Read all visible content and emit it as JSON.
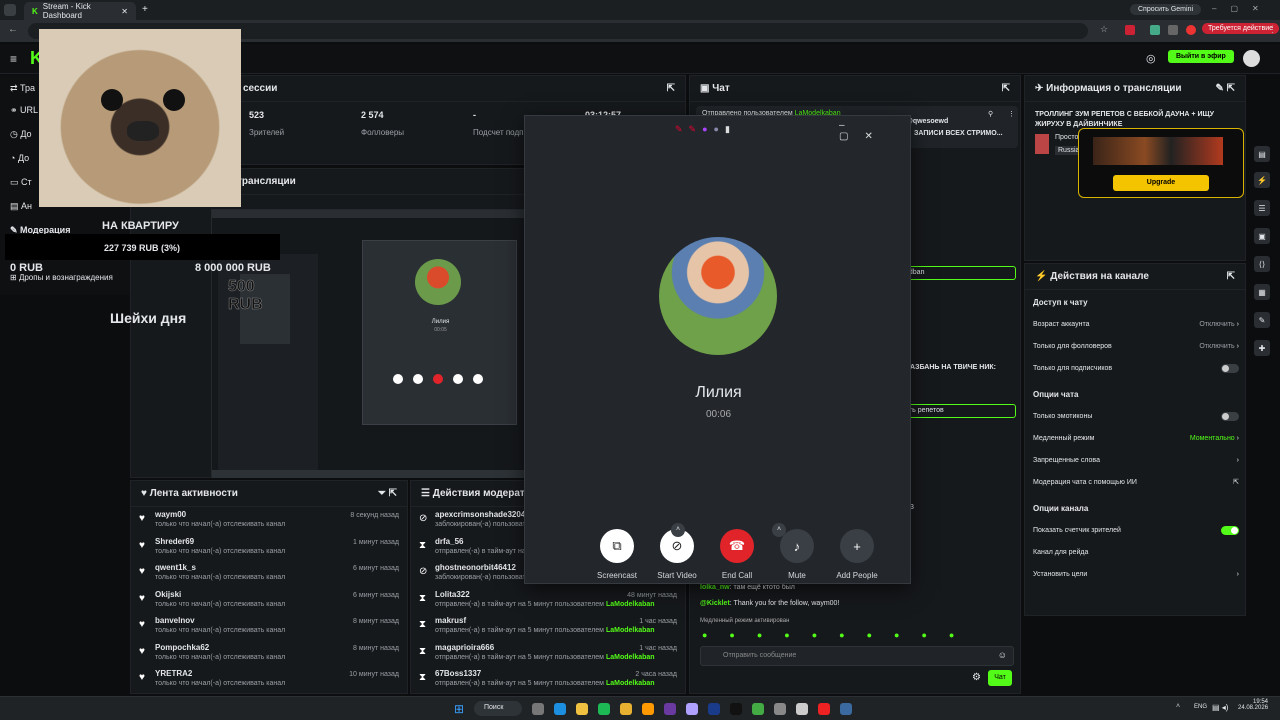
{
  "browser": {
    "tab_title": "Stream - Kick Dashboard",
    "gemini_label": "Спросить Gemini",
    "update_label": "Требуется действие"
  },
  "header": {
    "go_live": "Выйти в эфир"
  },
  "sidebar": {
    "items": [
      {
        "label": "Тра"
      },
      {
        "label": "URL"
      },
      {
        "label": "До"
      },
      {
        "label": "До"
      },
      {
        "label": "Ст"
      },
      {
        "label": "Ан"
      },
      {
        "label": "Модерация"
      },
      {
        "label": "Дропы и вознаграждения"
      }
    ]
  },
  "overlay": {
    "goal_title": "НА КВАРТИРУ",
    "goal_progress": "227 739 RUB (3%)",
    "goal_left": "0 RUB",
    "goal_right": "8 000 000 RUB",
    "donation": "500 RUB",
    "shake_label": "Шейхи дня"
  },
  "session": {
    "title": "сессии",
    "stats": [
      {
        "value": "523",
        "label": "Зрителей"
      },
      {
        "value": "2 574",
        "label": "Фолловеры"
      },
      {
        "value": "-",
        "label": "Подсчет подпи"
      },
      {
        "value": "03:12:57",
        "label": ""
      }
    ]
  },
  "stream_panel": {
    "title": "трансляции"
  },
  "activity": {
    "title": "Лента активности",
    "rows": [
      {
        "name": "waym00",
        "desc": "только что начал(-а) отслеживать канал",
        "time": "8 секунд назад"
      },
      {
        "name": "Shreder69",
        "desc": "только что начал(-а) отслеживать канал",
        "time": "1 минут назад"
      },
      {
        "name": "qwent1k_s",
        "desc": "только что начал(-а) отслеживать канал",
        "time": "6 минут назад"
      },
      {
        "name": "Okijski",
        "desc": "только что начал(-а) отслеживать канал",
        "time": "6 минут назад"
      },
      {
        "name": "banvelnov",
        "desc": "только что начал(-а) отслеживать канал",
        "time": "8 минут назад"
      },
      {
        "name": "Pompochka62",
        "desc": "только что начал(-а) отслеживать канал",
        "time": "8 минут назад"
      },
      {
        "name": "YRETRA2",
        "desc": "только что начал(-а) отслеживать канал",
        "time": "10 минут назад"
      }
    ]
  },
  "moderation": {
    "title": "Действия модерат",
    "rows": [
      {
        "name": "apexcrimsonshade32047",
        "desc": "заблокирован(-а) пользовател",
        "time": "",
        "icon": "ban"
      },
      {
        "name": "drfa_56",
        "desc": "отправлен(-а) в тайм-аут на 5 минут пользователем",
        "time": "",
        "icon": "timeout"
      },
      {
        "name": "ghostneonorbit46412",
        "desc": "заблокирован(-а) пользовател",
        "time": "",
        "icon": "ban"
      },
      {
        "name": "Lolita322",
        "desc": "отправлен(-а) в тайм-аут на 5 минут пользователем",
        "mod": "LaModelkaban",
        "time": "48 минут назад",
        "icon": "timeout"
      },
      {
        "name": "makrusf",
        "desc": "отправлен(-а) в тайм-аут на 5 минут пользователем",
        "mod": "LaModelkaban",
        "time": "1 час назад",
        "icon": "timeout"
      },
      {
        "name": "magaprioira666",
        "desc": "отправлен(-а) в тайм-аут на 5 минут пользователем",
        "mod": "LaModelkaban",
        "time": "1 час назад",
        "icon": "timeout"
      },
      {
        "name": "67Boss1337",
        "desc": "отправлен(-а) в тайм-аут на 5 минут пользователем",
        "mod": "LaModelkaban",
        "time": "2 часа назад",
        "icon": "timeout"
      }
    ]
  },
  "chat": {
    "title": "Чат",
    "pinned_from": "Отправлено пользователем",
    "pinned_user": "LaModelkaban",
    "pinned_mention": "@qwesoewd",
    "pinned_text": "ЗАПИСИ ВСЕХ СТРИМО...",
    "frag1": "edban",
    "frag2": "РАЗБАНЬ НА ТВИЧЕ НИК:",
    "frag3": "ить репетов",
    "frag4": "3",
    "msg1_user": "lolka_nw",
    "msg1_text": "там ещё ктото был",
    "msg2_user": "@Kicklet",
    "msg2_text": "Thank you for the follow, waym00!",
    "slow_notice": "Медленный режим активирован",
    "placeholder": "Отправить сообщение",
    "send": "Чат"
  },
  "stream_info": {
    "title": "Информация о трансляции",
    "stream_title": "ТРОЛЛИНГ ЗУМ РЕПЕТОВ С ВЕБКОЙ ДАУНА + ИЩУ ЖИРУХУ В ДАЙВИНЧИКЕ",
    "category": "Просто",
    "language": "Russia",
    "upgrade": "Upgrade"
  },
  "channel_actions": {
    "title": "Действия на канале",
    "chat_access": {
      "title": "Доступ к чату",
      "items": [
        {
          "label": "Возраст аккаунта",
          "value": "Отключить",
          "kind": "select"
        },
        {
          "label": "Только для фолловеров",
          "value": "Отключить",
          "kind": "select"
        },
        {
          "label": "Только для подписчиков",
          "value": "",
          "kind": "toggle"
        }
      ]
    },
    "chat_options": {
      "title": "Опции чата",
      "items": [
        {
          "label": "Только эмотиконы",
          "value": "",
          "kind": "toggle"
        },
        {
          "label": "Медленный режим",
          "value": "Моментально",
          "kind": "select"
        },
        {
          "label": "Запрещенные слова",
          "value": "",
          "kind": "link"
        },
        {
          "label": "Модерация чата с помощью ИИ",
          "value": "",
          "kind": "ext"
        }
      ]
    },
    "channel_options": {
      "title": "Опции канала",
      "items": [
        {
          "label": "Показать счетчик зрителей",
          "value": "",
          "kind": "toggle-on"
        },
        {
          "label": "Канал для рейда",
          "value": "",
          "kind": "none"
        },
        {
          "label": "Установить цели",
          "value": "",
          "kind": "link"
        }
      ]
    }
  },
  "call": {
    "name": "Лилия",
    "duration": "00:06",
    "buttons": [
      {
        "label": "Screencast"
      },
      {
        "label": "Start Video"
      },
      {
        "label": "End Call"
      },
      {
        "label": "Mute"
      },
      {
        "label": "Add People"
      }
    ]
  },
  "inner_call": {
    "name": "Лилия",
    "duration": "00:05"
  },
  "taskbar": {
    "search": "Поиск",
    "lang": "ENG",
    "time": "19:54",
    "date": "24.08.2026"
  },
  "colors": {
    "accent": "#53fc18",
    "end_call": "#e0242a"
  }
}
